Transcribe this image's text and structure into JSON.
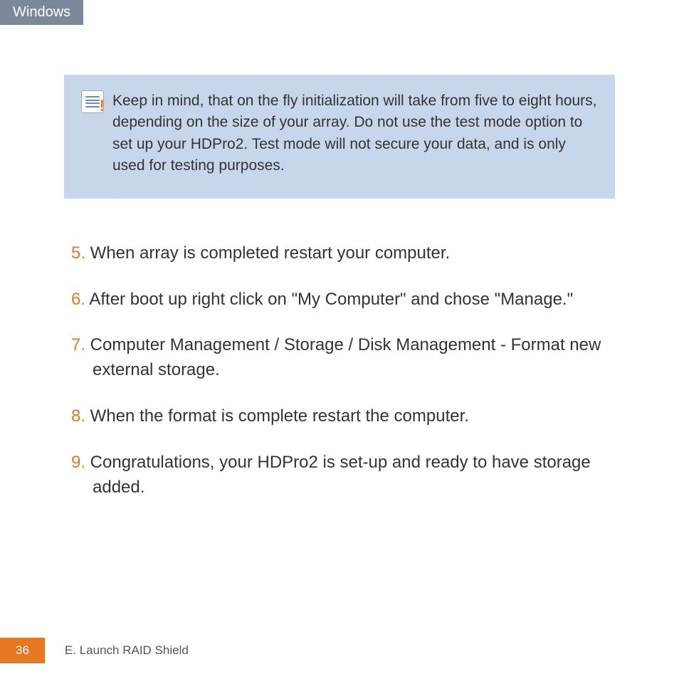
{
  "header": {
    "tab_label": "Windows"
  },
  "callout": {
    "text": "Keep in mind, that on the fly initialization will take from five to eight hours, depending on the size of your array. Do not use the test mode option to set up your HDPro2. Test mode will not secure your data, and is only used for testing purposes."
  },
  "steps": [
    {
      "num": "5.",
      "text": " When array is completed restart your computer."
    },
    {
      "num": "6.",
      "text": " After boot up right click on \"My Computer\" and chose \"Manage.\""
    },
    {
      "num": "7.",
      "text": " Computer Management / Storage / Disk Management - Format new external storage."
    },
    {
      "num": "8.",
      "text": " When the format is complete restart the computer."
    },
    {
      "num": "9.",
      "text": " Congratulations, your HDPro2 is set-up and ready to have storage added."
    }
  ],
  "footer": {
    "page_number": "36",
    "section_title": "E. Launch RAID Shield"
  }
}
